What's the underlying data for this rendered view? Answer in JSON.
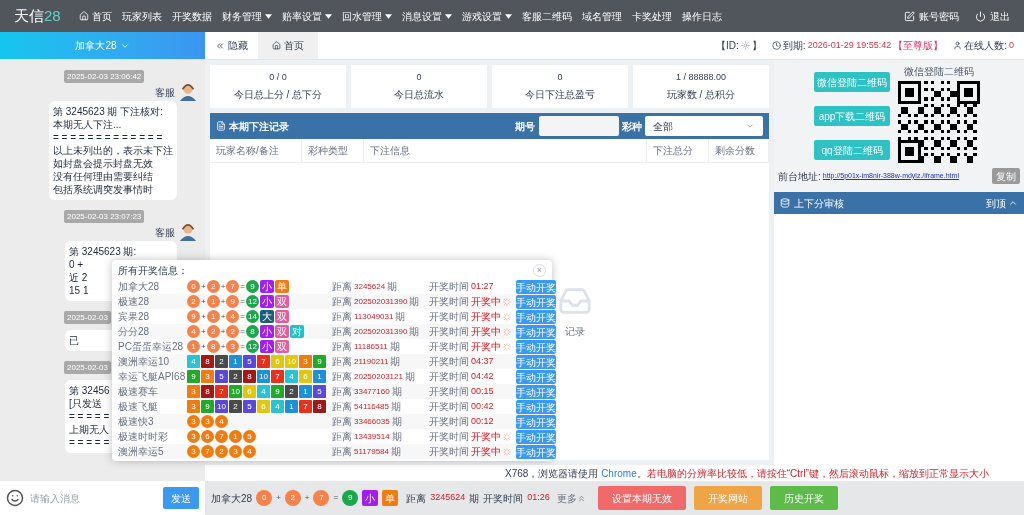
{
  "nav": {
    "logo": "天信",
    "logo_num": "28",
    "items": [
      {
        "label": "首页",
        "dropdown": false
      },
      {
        "label": "玩家列表",
        "dropdown": false
      },
      {
        "label": "开奖数据",
        "dropdown": false
      },
      {
        "label": "财务管理",
        "dropdown": true
      },
      {
        "label": "赔率设置",
        "dropdown": true
      },
      {
        "label": "回水管理",
        "dropdown": true
      },
      {
        "label": "消息设置",
        "dropdown": true
      },
      {
        "label": "游戏设置",
        "dropdown": true
      },
      {
        "label": "客服二维码",
        "dropdown": false
      },
      {
        "label": "域名管理",
        "dropdown": false
      },
      {
        "label": "卡奖处理",
        "dropdown": false
      },
      {
        "label": "操作日志",
        "dropdown": false
      }
    ],
    "account": "账号密码",
    "logout": "退出"
  },
  "chat": {
    "room": "加拿大28",
    "messages": [
      {
        "time": "2025-02-03 23:06:42",
        "sender": "客服",
        "lines": [
          "第 3245623 期 下注核对:",
          "本期无人下注...",
          "= = = = = = = = = = = = =",
          "以上未列出的，表示未下注",
          "如封盘会提示封盘无效",
          "没有任何理由需要纠结",
          "包括系统调突发事情时"
        ]
      },
      {
        "time": "2025-02-03 23:07:23",
        "sender": "客服",
        "lines": [
          "第 3245623 期:",
          "0 +",
          "近 2",
          "15 1"
        ]
      },
      {
        "time": "2025-02-03",
        "lines": [
          "已"
        ]
      },
      {
        "time": "2025-02-03",
        "lines": [
          "第 32456",
          "[只发送",
          "= = = = =",
          "上期无人",
          "= = = = ="
        ]
      }
    ],
    "placeholder": "请输入消息",
    "send": "发送"
  },
  "tabs": {
    "hide": "隐藏",
    "items": [
      {
        "label": "首页",
        "selected": true
      }
    ]
  },
  "info": {
    "id_label": "【ID:",
    "id_end": "】",
    "expire_label": "到期:",
    "expire": "2026-01-29 19:55:42",
    "edition": "【至尊版】",
    "online_label": "在线人数:",
    "online": "0"
  },
  "stats": [
    {
      "value": "0 / 0",
      "label": "今日总上分 / 总下分"
    },
    {
      "value": "0",
      "label": "今日总流水"
    },
    {
      "value": "0",
      "label": "今日下注总盈亏"
    },
    {
      "value": "1 / 88888.00",
      "label": "玩家数 / 总积分"
    }
  ],
  "bets": {
    "title": "本期下注记录",
    "period_label": "期号",
    "type_label": "彩种",
    "type_value": "全部",
    "columns": [
      "玩家名称/备注",
      "彩种类型",
      "下注信息",
      "下注总分",
      "剩余分数"
    ],
    "empty": "记录"
  },
  "notice": {
    "text": "X768，浏览器请使用 ",
    "link": "Chrome",
    "after": "。",
    "warning": "若电脑的分辨率比较低，请按住“Ctrl”键，然后滚动鼠标，缩放到正常显示大小"
  },
  "right": {
    "qr_buttons": [
      "微信登陆二维码",
      "app下载二维码",
      "qq登陆二维码"
    ],
    "qr_title": "微信登陆二维码",
    "address_label": "前台地址:",
    "address": "http://5p01x-im8nir-388w-mdylz./iframe.html",
    "copy": "复制",
    "review_title": "上下分审核",
    "top": "到顶"
  },
  "popup": {
    "title": "所有开奖信息：",
    "close": "×",
    "rows": [
      {
        "name": "加拿大28",
        "parts": [
          {
            "kind": "ball",
            "text": "0",
            "color": "#f5824a"
          },
          {
            "kind": "op",
            "text": "+"
          },
          {
            "kind": "ball",
            "text": "2",
            "color": "#f5824a"
          },
          {
            "kind": "op",
            "text": "+"
          },
          {
            "kind": "ball",
            "text": "7",
            "color": "#f5824a"
          },
          {
            "kind": "op",
            "text": "="
          },
          {
            "kind": "ball",
            "text": "9",
            "color": "#1ba84a"
          },
          {
            "kind": "tag",
            "text": "小",
            "color": "#a21ef0"
          },
          {
            "kind": "tag",
            "text": "单",
            "color": "#f07c10"
          }
        ],
        "dist_label": "距离",
        "period": "3245624",
        "unit": "期",
        "time_label": "开奖时间",
        "time": "01:27",
        "drawing": false,
        "button": "手动开奖"
      },
      {
        "name": "极速28",
        "parts": [
          {
            "kind": "ball",
            "text": "2",
            "color": "#f5824a"
          },
          {
            "kind": "op",
            "text": "+"
          },
          {
            "kind": "ball",
            "text": "1",
            "color": "#f5824a"
          },
          {
            "kind": "op",
            "text": "+"
          },
          {
            "kind": "ball",
            "text": "9",
            "color": "#f5824a"
          },
          {
            "kind": "op",
            "text": "="
          },
          {
            "kind": "ball",
            "text": "12",
            "color": "#1ba84a"
          },
          {
            "kind": "tag",
            "text": "小",
            "color": "#a21ef0"
          },
          {
            "kind": "tag",
            "text": "双",
            "color": "#e65b9c"
          }
        ],
        "dist_label": "距离",
        "period": "202502031390",
        "unit": "期",
        "time_label": "开奖时间",
        "time": "开奖中",
        "drawing": true,
        "button": "手动开奖"
      },
      {
        "name": "宾果28",
        "parts": [
          {
            "kind": "ball",
            "text": "9",
            "color": "#f5824a"
          },
          {
            "kind": "op",
            "text": "+"
          },
          {
            "kind": "ball",
            "text": "1",
            "color": "#f5824a"
          },
          {
            "kind": "op",
            "text": "+"
          },
          {
            "kind": "ball",
            "text": "4",
            "color": "#f5824a"
          },
          {
            "kind": "op",
            "text": "="
          },
          {
            "kind": "ball",
            "text": "14",
            "color": "#1ba84a"
          },
          {
            "kind": "tag",
            "text": "大",
            "color": "#1d5c7a"
          },
          {
            "kind": "tag",
            "text": "双",
            "color": "#e65b9c"
          }
        ],
        "dist_label": "距离",
        "period": "113049031",
        "unit": "期",
        "time_label": "开奖时间",
        "time": "开奖中",
        "drawing": true,
        "button": "手动开奖"
      },
      {
        "name": "分分28",
        "parts": [
          {
            "kind": "ball",
            "text": "4",
            "color": "#f5824a"
          },
          {
            "kind": "op",
            "text": "+"
          },
          {
            "kind": "ball",
            "text": "2",
            "color": "#f5824a"
          },
          {
            "kind": "op",
            "text": "+"
          },
          {
            "kind": "ball",
            "text": "2",
            "color": "#f5824a"
          },
          {
            "kind": "op",
            "text": "="
          },
          {
            "kind": "ball",
            "text": "8",
            "color": "#1ba84a"
          },
          {
            "kind": "tag",
            "text": "小",
            "color": "#a21ef0"
          },
          {
            "kind": "tag",
            "text": "双",
            "color": "#e65b9c"
          },
          {
            "kind": "tag",
            "text": "对",
            "color": "#22c1c8"
          }
        ],
        "dist_label": "距离",
        "period": "202502031390",
        "unit": "期",
        "time_label": "开奖时间",
        "time": "开奖中",
        "drawing": true,
        "button": "手动开奖"
      },
      {
        "name": "PC蛋蛋幸运28",
        "parts": [
          {
            "kind": "ball",
            "text": "1",
            "color": "#f5824a"
          },
          {
            "kind": "op",
            "text": "+"
          },
          {
            "kind": "ball",
            "text": "8",
            "color": "#f5824a"
          },
          {
            "kind": "op",
            "text": "+"
          },
          {
            "kind": "ball",
            "text": "3",
            "color": "#f5824a"
          },
          {
            "kind": "op",
            "text": "="
          },
          {
            "kind": "ball",
            "text": "12",
            "color": "#1ba84a"
          },
          {
            "kind": "tag",
            "text": "小",
            "color": "#a21ef0"
          },
          {
            "kind": "tag",
            "text": "双",
            "color": "#e65b9c"
          }
        ],
        "dist_label": "距离",
        "period": "11186511",
        "unit": "期",
        "time_label": "开奖时间",
        "time": "开奖中",
        "drawing": true,
        "button": "手动开奖"
      },
      {
        "name": "澳洲幸运10",
        "parts": [
          {
            "kind": "square",
            "text": "4",
            "color": "#2bc3d3"
          },
          {
            "kind": "square",
            "text": "8",
            "color": "#a01818"
          },
          {
            "kind": "square",
            "text": "2",
            "color": "#4a4a4a"
          },
          {
            "kind": "square",
            "text": "1",
            "color": "#1e90d8"
          },
          {
            "kind": "square",
            "text": "5",
            "color": "#5a48d8"
          },
          {
            "kind": "square",
            "text": "7",
            "color": "#e8301c"
          },
          {
            "kind": "square",
            "text": "6",
            "color": "#e0c810"
          },
          {
            "kind": "square",
            "text": "10",
            "color": "#e0c810"
          },
          {
            "kind": "square",
            "text": "3",
            "color": "#f07c10"
          },
          {
            "kind": "square",
            "text": "9",
            "color": "#22a82a"
          }
        ],
        "dist_label": "距离",
        "period": "21190211",
        "unit": "期",
        "time_label": "开奖时间",
        "time": "04:37",
        "drawing": false,
        "button": "手动开奖"
      },
      {
        "name": "幸运飞艇API68",
        "parts": [
          {
            "kind": "square",
            "text": "9",
            "color": "#22a82a"
          },
          {
            "kind": "square",
            "text": "3",
            "color": "#f07c10"
          },
          {
            "kind": "square",
            "text": "5",
            "color": "#5a48d8"
          },
          {
            "kind": "square",
            "text": "2",
            "color": "#4a4a4a"
          },
          {
            "kind": "square",
            "text": "8",
            "color": "#a01818"
          },
          {
            "kind": "square",
            "text": "10",
            "color": "#1e90d8"
          },
          {
            "kind": "square",
            "text": "7",
            "color": "#e8301c"
          },
          {
            "kind": "square",
            "text": "4",
            "color": "#2bc3d3"
          },
          {
            "kind": "square",
            "text": "6",
            "color": "#e0c810"
          },
          {
            "kind": "square",
            "text": "1",
            "color": "#1e90d8"
          }
        ],
        "dist_label": "距离",
        "period": "20250203121",
        "unit": "期",
        "time_label": "开奖时间",
        "time": "04:42",
        "drawing": false,
        "button": "手动开奖"
      },
      {
        "name": "极速赛车",
        "parts": [
          {
            "kind": "square",
            "text": "3",
            "color": "#f07c10"
          },
          {
            "kind": "square",
            "text": "8",
            "color": "#a01818"
          },
          {
            "kind": "square",
            "text": "7",
            "color": "#e8301c"
          },
          {
            "kind": "square",
            "text": "10",
            "color": "#22a82a"
          },
          {
            "kind": "square",
            "text": "6",
            "color": "#e0c810"
          },
          {
            "kind": "square",
            "text": "4",
            "color": "#2bc3d3"
          },
          {
            "kind": "square",
            "text": "9",
            "color": "#22a82a"
          },
          {
            "kind": "square",
            "text": "2",
            "color": "#4a4a4a"
          },
          {
            "kind": "square",
            "text": "1",
            "color": "#1e90d8"
          },
          {
            "kind": "square",
            "text": "5",
            "color": "#5a48d8"
          }
        ],
        "dist_label": "距离",
        "period": "33477160",
        "unit": "期",
        "time_label": "开奖时间",
        "time": "00:15",
        "drawing": false,
        "button": "手动开奖"
      },
      {
        "name": "极速飞艇",
        "parts": [
          {
            "kind": "square",
            "text": "3",
            "color": "#f07c10"
          },
          {
            "kind": "square",
            "text": "9",
            "color": "#22a82a"
          },
          {
            "kind": "square",
            "text": "10",
            "color": "#5a48d8"
          },
          {
            "kind": "square",
            "text": "2",
            "color": "#4a4a4a"
          },
          {
            "kind": "square",
            "text": "5",
            "color": "#5a48d8"
          },
          {
            "kind": "square",
            "text": "6",
            "color": "#e0c810"
          },
          {
            "kind": "square",
            "text": "4",
            "color": "#2bc3d3"
          },
          {
            "kind": "square",
            "text": "1",
            "color": "#1e90d8"
          },
          {
            "kind": "square",
            "text": "7",
            "color": "#e8301c"
          },
          {
            "kind": "square",
            "text": "8",
            "color": "#a01818"
          }
        ],
        "dist_label": "距离",
        "period": "54116485",
        "unit": "期",
        "time_label": "开奖时间",
        "time": "00:42",
        "drawing": false,
        "button": "手动开奖"
      },
      {
        "name": "极速快3",
        "parts": [
          {
            "kind": "ball",
            "text": "3",
            "color": "#f07c10"
          },
          {
            "kind": "ball",
            "text": "3",
            "color": "#f07c10"
          },
          {
            "kind": "ball",
            "text": "4",
            "color": "#f07c10"
          }
        ],
        "dist_label": "距离",
        "period": "33466035",
        "unit": "期",
        "time_label": "开奖时间",
        "time": "00:12",
        "drawing": false,
        "button": "手动开奖"
      },
      {
        "name": "极速时时彩",
        "parts": [
          {
            "kind": "ball",
            "text": "3",
            "color": "#f07c10"
          },
          {
            "kind": "ball",
            "text": "6",
            "color": "#f07c10"
          },
          {
            "kind": "ball",
            "text": "7",
            "color": "#f07c10"
          },
          {
            "kind": "ball",
            "text": "1",
            "color": "#f07c10"
          },
          {
            "kind": "ball",
            "text": "5",
            "color": "#f07c10"
          }
        ],
        "dist_label": "距离",
        "period": "13439514",
        "unit": "期",
        "time_label": "开奖时间",
        "time": "开奖中",
        "drawing": true,
        "button": "手动开奖"
      },
      {
        "name": "澳洲幸运5",
        "parts": [
          {
            "kind": "ball",
            "text": "3",
            "color": "#f07c10"
          },
          {
            "kind": "ball",
            "text": "7",
            "color": "#f07c10"
          },
          {
            "kind": "ball",
            "text": "2",
            "color": "#f07c10"
          },
          {
            "kind": "ball",
            "text": "3",
            "color": "#f07c10"
          },
          {
            "kind": "ball",
            "text": "4",
            "color": "#f07c10"
          }
        ],
        "dist_label": "距离",
        "period": "51179584",
        "unit": "期",
        "time_label": "开奖时间",
        "time": "开奖中",
        "drawing": true,
        "button": "手动开奖"
      }
    ]
  },
  "bottom": {
    "name": "加拿大28",
    "parts": [
      {
        "kind": "ball",
        "text": "0",
        "color": "#f5824a"
      },
      {
        "kind": "op",
        "text": "+"
      },
      {
        "kind": "ball",
        "text": "2",
        "color": "#f5824a"
      },
      {
        "kind": "op",
        "text": "+"
      },
      {
        "kind": "ball",
        "text": "7",
        "color": "#f5824a"
      },
      {
        "kind": "op",
        "text": "="
      },
      {
        "kind": "ball",
        "text": "9",
        "color": "#1ba84a"
      },
      {
        "kind": "tag",
        "text": "小",
        "color": "#a21ef0"
      },
      {
        "kind": "tag",
        "text": "单",
        "color": "#f07c10"
      }
    ],
    "dist_label": "距离",
    "period": "3245624",
    "unit": "期",
    "time_label": "开奖时间",
    "time": "01:26",
    "more": "更多",
    "buttons": [
      {
        "label": "设置本期无效",
        "color": "#f06a6a"
      },
      {
        "label": "开奖网站",
        "color": "#efa446"
      },
      {
        "label": "历史开奖",
        "color": "#5dbb4a"
      }
    ]
  }
}
